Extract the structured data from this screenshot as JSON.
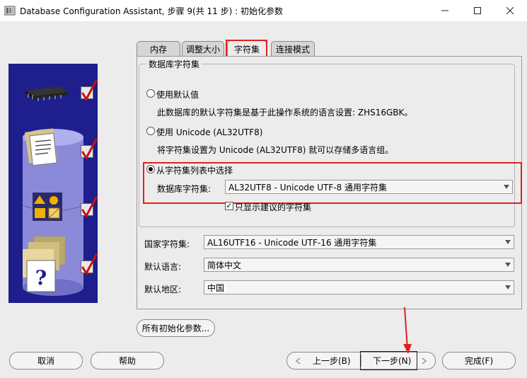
{
  "window": {
    "title": "Database Configuration Assistant, 步骤 9(共 11 步) : 初始化参数",
    "minimize_icon": "minimize-icon",
    "maximize_icon": "maximize-icon",
    "close_icon": "close-icon"
  },
  "tabs": [
    {
      "label": "内存"
    },
    {
      "label": "调整大小"
    },
    {
      "label": "字符集",
      "active": true
    },
    {
      "label": "连接模式"
    }
  ],
  "db_charset": {
    "legend": "数据库字符集",
    "option_default": "使用默认值",
    "option_default_desc": "此数据库的默认字符集是基于此操作系统的语言设置: ZHS16GBK。",
    "option_unicode": "使用 Unicode (AL32UTF8)",
    "option_unicode_desc": "将字符集设置为 Unicode (AL32UTF8) 就可以存储多语言组。",
    "option_list": "从字符集列表中选择",
    "selected_option": "从字符集列表中选择",
    "charset_label": "数据库字符集:",
    "charset_value": "AL32UTF8 - Unicode UTF-8 通用字符集",
    "show_recommended_label": "只显示建议的字符集",
    "show_recommended_checked": true
  },
  "national": {
    "label": "国家字符集:",
    "value": "AL16UTF16 - Unicode UTF-16 通用字符集"
  },
  "language": {
    "label": "默认语言:",
    "value": "简体中文"
  },
  "territory": {
    "label": "默认地区:",
    "value": "中国"
  },
  "buttons": {
    "all_params": "所有初始化参数...",
    "cancel": "取消",
    "help": "帮助",
    "back": "上一步(B)",
    "next": "下一步(N)",
    "finish": "完成(F)"
  },
  "colors": {
    "sidebar_bg": "#1e1e8c",
    "highlight_red": "#e02020",
    "check_red": "#c81010"
  }
}
